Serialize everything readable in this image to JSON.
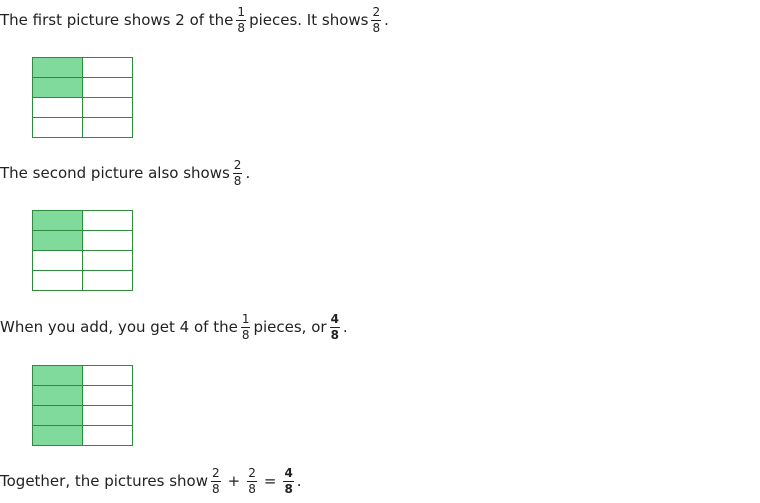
{
  "line1": {
    "pre": "The first picture shows 2 of the",
    "frac_a": {
      "num": "1",
      "den": "8"
    },
    "mid": "pieces. It shows",
    "frac_b": {
      "num": "2",
      "den": "8"
    },
    "post": "."
  },
  "line2": {
    "pre": "The second picture also shows",
    "frac": {
      "num": "2",
      "den": "8"
    },
    "post": "."
  },
  "line3": {
    "pre": "When you add, you get 4 of the",
    "frac_a": {
      "num": "1",
      "den": "8"
    },
    "mid": "pieces, or",
    "frac_b": {
      "num": "4",
      "den": "8"
    },
    "post": "."
  },
  "line4": {
    "pre": "Together, the pictures show",
    "frac_a": {
      "num": "2",
      "den": "8"
    },
    "plus": "+",
    "frac_b": {
      "num": "2",
      "den": "8"
    },
    "equals": "=",
    "frac_c": {
      "num": "4",
      "den": "8"
    },
    "post": "."
  },
  "grids": [
    {
      "shaded": [
        1,
        0,
        1,
        0,
        0,
        0,
        0,
        0
      ]
    },
    {
      "shaded": [
        1,
        0,
        1,
        0,
        0,
        0,
        0,
        0
      ]
    },
    {
      "shaded": [
        1,
        0,
        1,
        0,
        1,
        0,
        1,
        0
      ]
    }
  ],
  "colors": {
    "shaded": "#7fda9b",
    "grid_line": "#2e8b3e"
  }
}
